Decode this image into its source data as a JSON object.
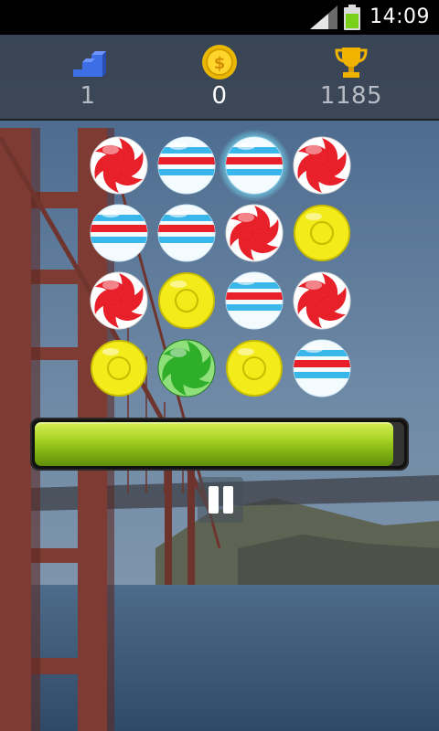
{
  "status_bar": {
    "time": "14:09",
    "icons": [
      "signal-icon",
      "battery-icon"
    ]
  },
  "header": {
    "level": {
      "icon": "stairs-icon",
      "value": "1"
    },
    "coins": {
      "icon": "coin-icon",
      "value": "0"
    },
    "best": {
      "icon": "trophy-icon",
      "value": "1185"
    }
  },
  "board": {
    "rows": [
      [
        "swirl-red",
        "stripe-blue-red",
        "stripe-blue-red",
        "swirl-red"
      ],
      [
        "stripe-blue-red",
        "stripe-blue-red",
        "swirl-red",
        "ring-yellow"
      ],
      [
        "swirl-red",
        "ring-yellow",
        "stripe-blue-red",
        "swirl-red"
      ],
      [
        "ring-yellow",
        "swirl-green",
        "ring-yellow",
        "stripe-blue-red"
      ]
    ],
    "selected": {
      "row": 0,
      "col": 2
    }
  },
  "timer": {
    "progress": 0.97
  },
  "pause": {
    "icon": "pause-icon"
  },
  "colors": {
    "timer_fill": "#a9d427",
    "swirl_red": "#e8202a",
    "ring_yellow": "#f4ec1a",
    "swirl_green": "#2fae2a",
    "stripe_blue": "#3ab7ea",
    "selection_glow": "#78e6ff"
  }
}
